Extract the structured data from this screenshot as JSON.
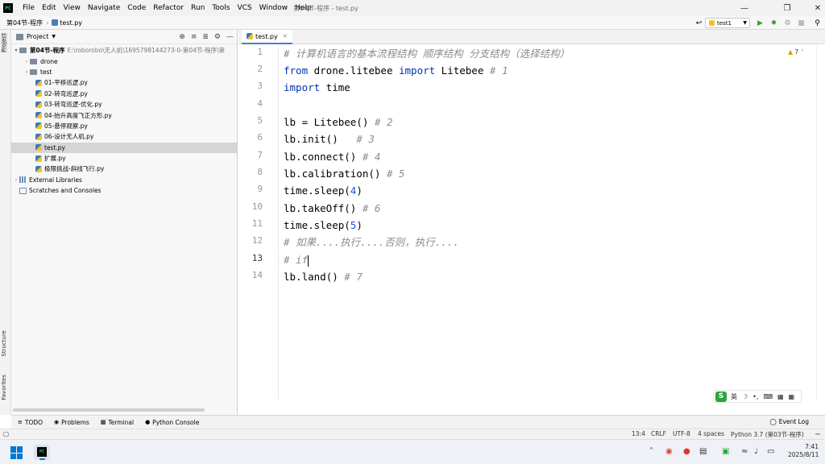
{
  "menu": {
    "items": [
      "File",
      "Edit",
      "View",
      "Navigate",
      "Code",
      "Refactor",
      "Run",
      "Tools",
      "VCS",
      "Window",
      "Help"
    ],
    "window_title": "第04节-程序 - test.py"
  },
  "nav": {
    "project": "第04节-程序",
    "file": "test.py",
    "run_config": "test1"
  },
  "project_panel": {
    "title": "Project",
    "root_name": "第04节-程序",
    "root_path": "E:\\roborobo\\无人机\\1695798144273-0-第04节-程序\\第",
    "items": [
      {
        "name": "drone",
        "kind": "folder"
      },
      {
        "name": "test",
        "kind": "folder"
      },
      {
        "name": "01-平移巡逻.py",
        "kind": "py"
      },
      {
        "name": "02-转弯巡逻.py",
        "kind": "py"
      },
      {
        "name": "03-转弯巡逻-优化.py",
        "kind": "py"
      },
      {
        "name": "04-抬升高度飞正方形.py",
        "kind": "py"
      },
      {
        "name": "05-悬停观察.py",
        "kind": "py"
      },
      {
        "name": "06-设计无人机.py",
        "kind": "py"
      },
      {
        "name": "test.py",
        "kind": "py"
      },
      {
        "name": "扩展.py",
        "kind": "py"
      },
      {
        "name": "极限挑战-斜线飞行.py",
        "kind": "py"
      }
    ],
    "external_libraries": "External Libraries",
    "scratches": "Scratches and Consoles"
  },
  "editor": {
    "tab": "test.py",
    "inspection_count": "7",
    "line_numbers": [
      "1",
      "2",
      "3",
      "4",
      "5",
      "6",
      "7",
      "8",
      "9",
      "10",
      "11",
      "12",
      "13",
      "14"
    ]
  },
  "ime": {
    "logo": "S",
    "mode": "英"
  },
  "left_strip": {
    "project": "Project",
    "structure": "Structure",
    "favorites": "Favorites"
  },
  "bottom_tools": {
    "todo": "TODO",
    "problems": "Problems",
    "terminal": "Terminal",
    "python_console": "Python Console",
    "event_log": "Event Log"
  },
  "status": {
    "position": "13:4",
    "line_sep": "CRLF",
    "encoding": "UTF-8",
    "indent": "4 spaces",
    "interpreter": "Python 3.7 (第03节-程序)"
  },
  "taskbar": {
    "time": "7:41",
    "date": "2025/8/11"
  }
}
